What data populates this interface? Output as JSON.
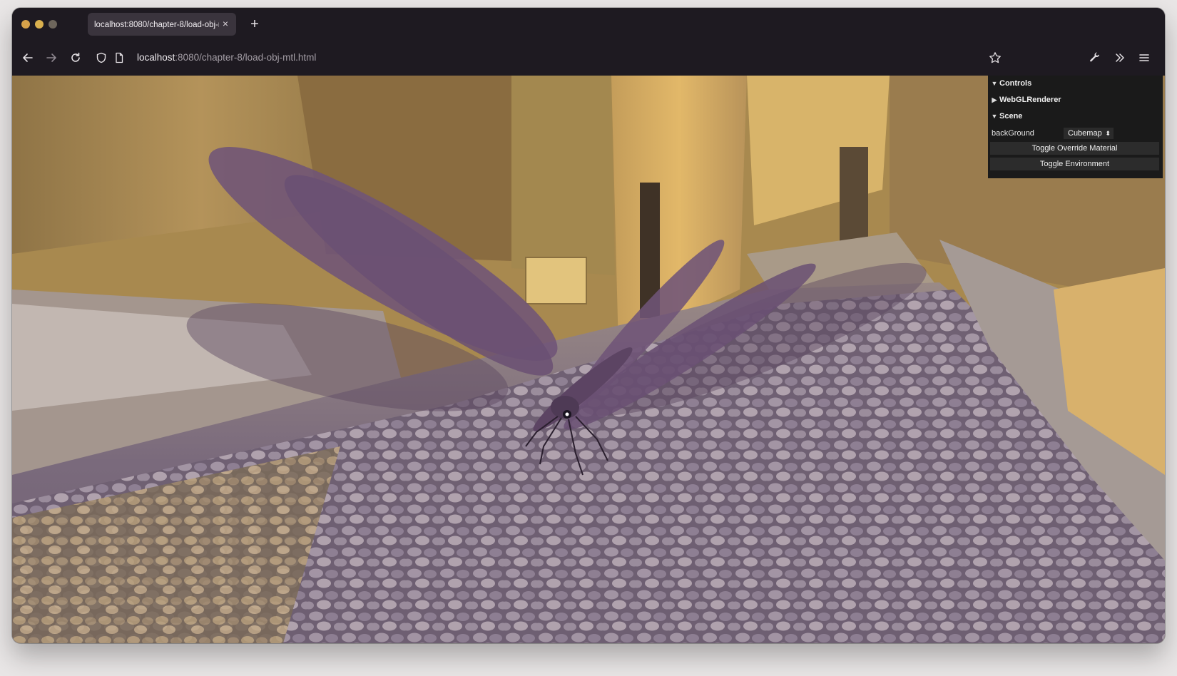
{
  "browser": {
    "tab_title": "localhost:8080/chapter-8/load-obj-mtl.html",
    "tab_close": "×",
    "new_tab": "+",
    "url_host": "localhost",
    "url_rest": ":8080/chapter-8/load-obj-mtl.html"
  },
  "icons": [
    "back-icon",
    "forward-icon",
    "reload-icon",
    "shield-icon",
    "page-icon",
    "bookmark-star-icon",
    "wrench-icon",
    "overflow-chevrons-icon",
    "menu-icon"
  ],
  "gui": {
    "controls_label": "Controls",
    "renderer_label": "WebGLRenderer",
    "scene_label": "Scene",
    "background_label": "backGround",
    "background_value": "Cubemap",
    "override_button": "Toggle Override Material",
    "environment_button": "Toggle Environment"
  },
  "colors": {
    "wing_purple": "#6f5477",
    "wall_gold": "#c6a15c",
    "cobble_purple": "#7d6b80"
  }
}
